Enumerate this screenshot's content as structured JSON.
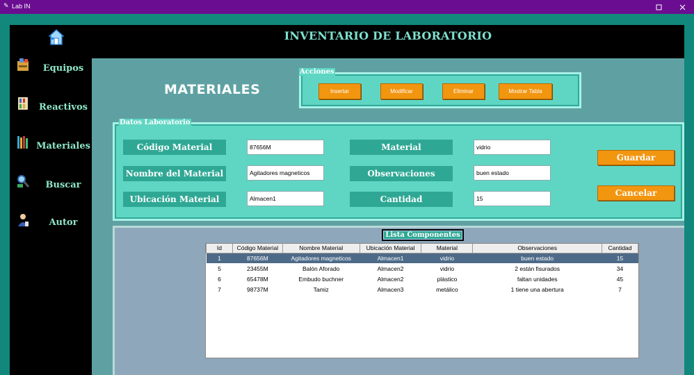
{
  "window": {
    "title": "Lab IN",
    "restore_icon": "restore-icon",
    "close_icon": "close-icon"
  },
  "header": {
    "title": "INVENTARIO DE LABORATORIO"
  },
  "sidebar": {
    "home_icon": "home-icon",
    "items": [
      {
        "label": "Equipos",
        "icon": "equipos-icon"
      },
      {
        "label": "Reactivos",
        "icon": "reactivos-icon"
      },
      {
        "label": "Materiales",
        "icon": "materiales-icon"
      },
      {
        "label": "Buscar",
        "icon": "buscar-icon"
      },
      {
        "label": "Autor",
        "icon": "autor-icon"
      }
    ]
  },
  "page": {
    "title": "MATERIALES"
  },
  "acciones": {
    "legend": "Acciones",
    "buttons": [
      "Insertar",
      "Modificar",
      "Eliminar",
      "Mostrar Tabla"
    ]
  },
  "datos": {
    "legend": "Datos Laboratorio",
    "fields": {
      "codigo": {
        "label": "Código Material",
        "value": "87656M"
      },
      "nombre": {
        "label": "Nombre del Material",
        "value": "Agitadores magneticos"
      },
      "ubicacion": {
        "label": "Ubicación Material",
        "value": "Almacen1"
      },
      "material": {
        "label": "Material",
        "value": "vidrio"
      },
      "observaciones": {
        "label": "Observaciones",
        "value": "buen estado"
      },
      "cantidad": {
        "label": "Cantidad",
        "value": "15"
      }
    },
    "guardar": "Guardar",
    "cancelar": "Cancelar"
  },
  "list": {
    "title": "Lista Componentes",
    "columns": [
      "Id",
      "Código Material",
      "Nombre Material",
      "Ubicación Material",
      "Material",
      "Observaciones",
      "Cantidad"
    ],
    "rows": [
      [
        "1",
        "87656M",
        "Agitadores magneticos",
        "Almacen1",
        "vidrio",
        "buen estado",
        "15"
      ],
      [
        "5",
        "23455M",
        "Balón Aforado",
        "Almacen2",
        "vidrio",
        "2 están fisurados",
        "34"
      ],
      [
        "6",
        "65478M",
        "Embudo buchner",
        "Almacen2",
        "plástico",
        "faltan unidades",
        "45"
      ],
      [
        "7",
        "98737M",
        "Tamiz",
        "Almacen3",
        "metálico",
        "1 tiene una abertura",
        "7"
      ]
    ],
    "selected_row": 0
  }
}
